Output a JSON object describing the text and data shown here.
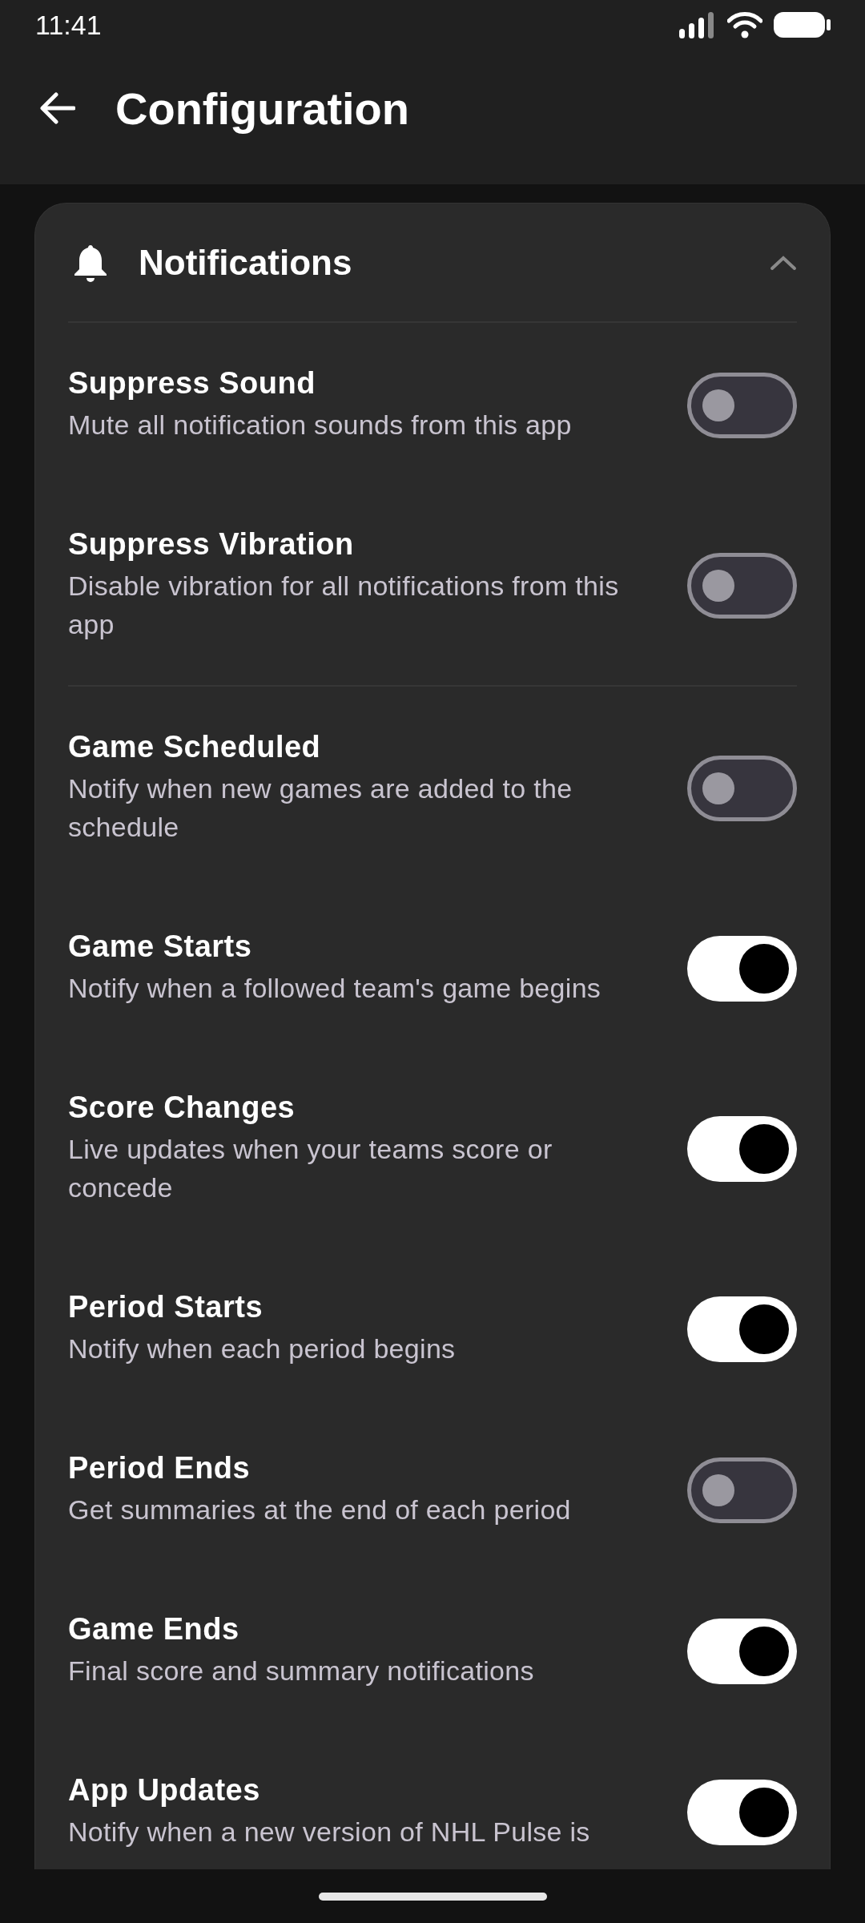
{
  "status_bar": {
    "time": "11:41"
  },
  "header": {
    "title": "Configuration"
  },
  "card": {
    "title": "Notifications",
    "expanded": true,
    "sections": [
      {
        "items": [
          {
            "title": "Suppress Sound",
            "description": "Mute all notification sounds from this app",
            "on": false
          },
          {
            "title": "Suppress Vibration",
            "description": "Disable vibration for all notifications from this app",
            "on": false
          }
        ]
      },
      {
        "items": [
          {
            "title": "Game Scheduled",
            "description": "Notify when new games are added to the schedule",
            "on": false
          },
          {
            "title": "Game Starts",
            "description": "Notify when a followed team's game begins",
            "on": true
          },
          {
            "title": "Score Changes",
            "description": "Live updates when your teams score or concede",
            "on": true
          },
          {
            "title": "Period Starts",
            "description": "Notify when each period begins",
            "on": true
          },
          {
            "title": "Period Ends",
            "description": "Get summaries at the end of each period",
            "on": false
          },
          {
            "title": "Game Ends",
            "description": "Final score and summary notifications",
            "on": true
          },
          {
            "title": "App Updates",
            "description": "Notify when a new version of NHL Pulse is",
            "on": true
          }
        ]
      }
    ]
  }
}
